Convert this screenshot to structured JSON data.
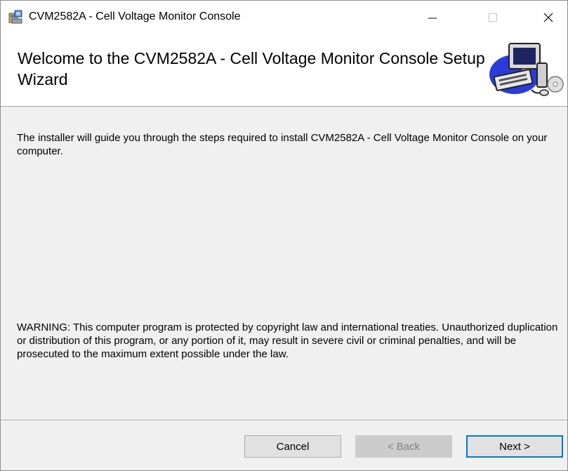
{
  "window": {
    "title": "CVM2582A - Cell Voltage Monitor Console"
  },
  "banner": {
    "title": "Welcome to the CVM2582A - Cell Voltage Monitor Console Setup Wizard"
  },
  "body": {
    "intro": "The installer will guide you through the steps required to install CVM2582A - Cell Voltage Monitor Console on your computer.",
    "warning": "WARNING: This computer program is protected by copyright law and international treaties. Unauthorized duplication or distribution of this program, or any portion of it, may result in severe civil or criminal penalties, and will be prosecuted to the maximum extent possible under the law."
  },
  "buttons": {
    "cancel": "Cancel",
    "back": "< Back",
    "next": "Next >"
  },
  "icons": {
    "app": "installer-package-icon",
    "banner": "computer-setup-icon",
    "minimize": "minimize-icon",
    "maximize": "maximize-icon",
    "close": "close-icon"
  },
  "colors": {
    "accent": "#0078d7",
    "disabled_text": "#838383"
  }
}
